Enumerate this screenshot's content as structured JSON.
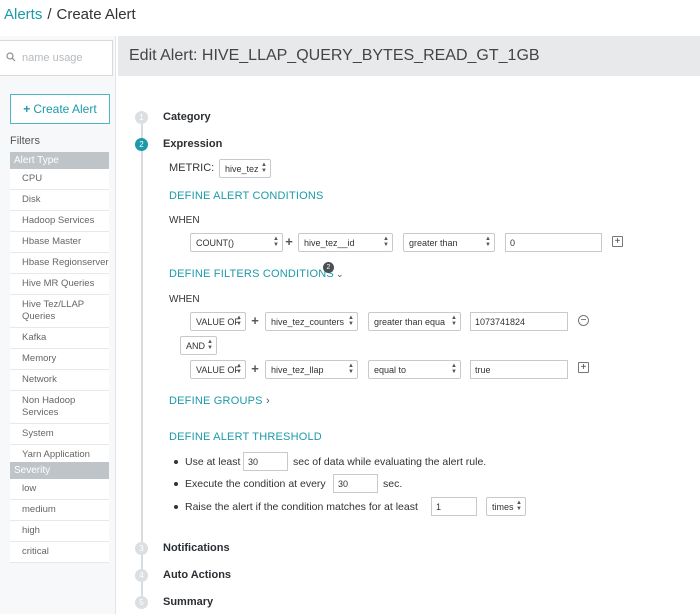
{
  "breadcrumb": {
    "root": "Alerts",
    "separator": "/",
    "current": "Create Alert"
  },
  "sidebar": {
    "search_placeholder": "name usage",
    "create_label": "Create Alert",
    "filters_label": "Filters",
    "alert_type": {
      "heading": "Alert Type",
      "items": [
        "CPU",
        "Disk",
        "Hadoop Services",
        "Hbase Master",
        "Hbase Regionserver",
        "Hive MR Queries",
        "Hive Tez/LLAP Queries",
        "Kafka",
        "Memory",
        "Network",
        "Non Hadoop Services",
        "System",
        "Yarn Application"
      ]
    },
    "severity": {
      "heading": "Severity",
      "items": [
        "low",
        "medium",
        "high",
        "critical"
      ]
    }
  },
  "main": {
    "title": "Edit Alert: HIVE_LLAP_QUERY_BYTES_READ_GT_1GB",
    "steps": [
      {
        "num": "1",
        "label": "Category"
      },
      {
        "num": "2",
        "label": "Expression"
      },
      {
        "num": "3",
        "label": "Notifications"
      },
      {
        "num": "4",
        "label": "Auto Actions"
      },
      {
        "num": "5",
        "label": "Summary"
      }
    ],
    "metric": {
      "label": "METRIC:",
      "value": "hive_tez"
    },
    "conditions": {
      "heading": "DEFINE ALERT CONDITIONS",
      "when": "WHEN",
      "func": "COUNT()",
      "field": "hive_tez__id",
      "operator": "greater than",
      "value": "0"
    },
    "filters": {
      "heading": "DEFINE FILTERS CONDITIONS",
      "count": "2",
      "when": "WHEN",
      "row1": {
        "func": "VALUE OF",
        "field": "hive_tez_counters",
        "operator": "greater than equa",
        "value": "1073741824"
      },
      "joiner": "AND",
      "row2": {
        "func": "VALUE OF",
        "field": "hive_tez_llap",
        "operator": "equal to",
        "value": "true"
      }
    },
    "groups": {
      "heading": "DEFINE GROUPS"
    },
    "threshold": {
      "heading": "DEFINE ALERT THRESHOLD",
      "line1_pre": "Use at least",
      "line1_value": "30",
      "line1_post": "sec of data while evaluating the alert rule.",
      "line2_pre": "Execute the condition at every",
      "line2_value": "30",
      "line2_post": "sec.",
      "line3_pre": "Raise the alert if the condition matches for at least",
      "line3_value": "1",
      "line3_unit": "times"
    }
  }
}
